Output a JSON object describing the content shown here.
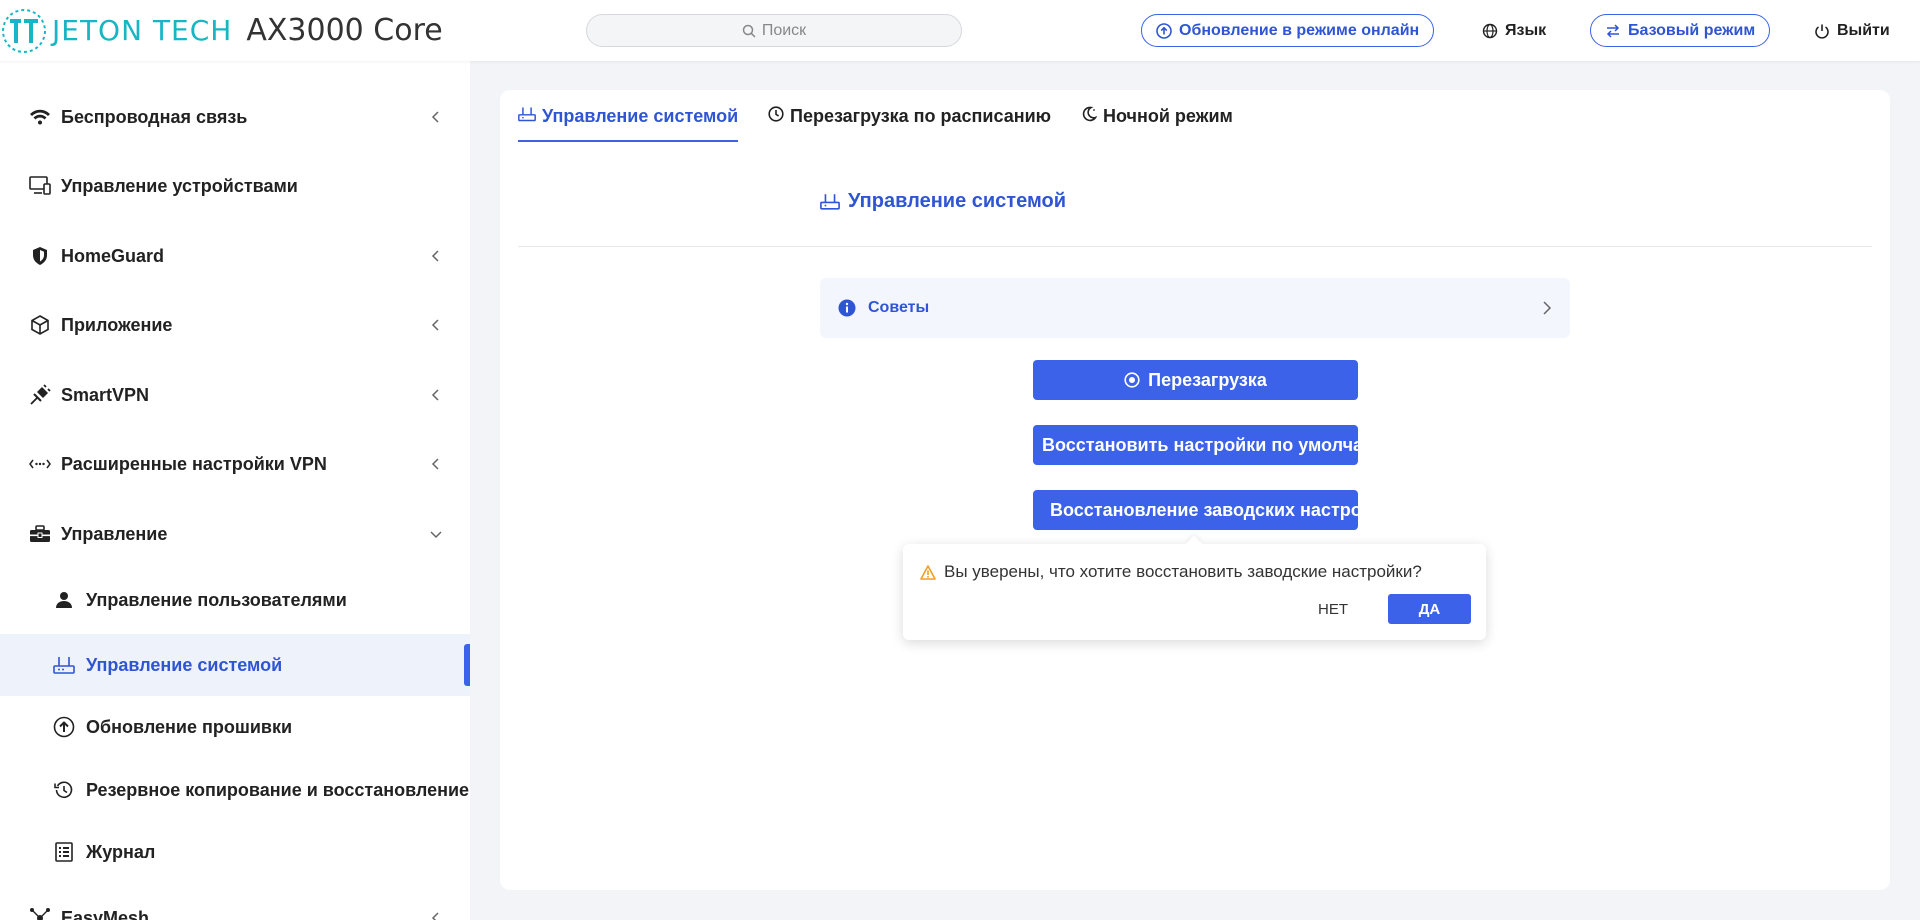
{
  "header": {
    "brand": "JETON TECH",
    "model": "AX3000 Core",
    "search_placeholder": "Поиск",
    "online_update": "Обновление в режиме онлайн",
    "language": "Язык",
    "basic_mode": "Базовый режим",
    "logout": "Выйти"
  },
  "sidebar": {
    "items": [
      {
        "label": "Беспроводная связь",
        "icon": "wifi-icon"
      },
      {
        "label": "Управление устройствами",
        "icon": "monitor-icon"
      },
      {
        "label": "HomeGuard",
        "icon": "shield-icon"
      },
      {
        "label": "Приложение",
        "icon": "cube-icon"
      },
      {
        "label": "SmartVPN",
        "icon": "plug-icon"
      },
      {
        "label": "Расширенные настройки VPN",
        "icon": "dots-arrows-icon"
      },
      {
        "label": "Управление",
        "icon": "toolbox-icon"
      }
    ],
    "sub_items": [
      {
        "label": "Управление пользователями",
        "icon": "user-icon"
      },
      {
        "label": "Управление системой",
        "icon": "router-icon"
      },
      {
        "label": "Обновление прошивки",
        "icon": "upload-circle-icon"
      },
      {
        "label": "Резервное копирование и восстановление",
        "icon": "history-icon"
      },
      {
        "label": "Журнал",
        "icon": "list-icon"
      }
    ],
    "next_item": "EasyMesh"
  },
  "tabs": [
    {
      "label": "Управление системой",
      "active": true
    },
    {
      "label": "Перезагрузка по расписанию",
      "active": false
    },
    {
      "label": "Ночной режим",
      "active": false
    }
  ],
  "main": {
    "section_title": "Управление системой",
    "tips_label": "Советы",
    "reboot_button": "Перезагрузка",
    "restore_default_button": "Восстановить настройки по умолчанию",
    "factory_reset_button": "Восстановление заводских настроек"
  },
  "popconfirm": {
    "message": "Вы уверены, что хотите восстановить заводские настройки?",
    "no": "НЕТ",
    "yes": "ДА"
  },
  "colors": {
    "accent": "#3b62e8",
    "brand": "#17b6c4",
    "warning": "#f0a020"
  }
}
